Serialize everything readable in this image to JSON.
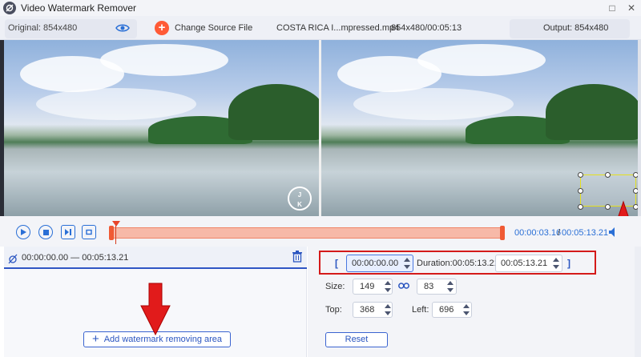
{
  "window": {
    "title": "Video Watermark Remover",
    "restore_symbol": "□",
    "close_symbol": "✕"
  },
  "topbar": {
    "original_label": "Original: 854x480",
    "change_source_label": "Change Source File",
    "change_source_plus": "+",
    "filename": "COSTA RICA I...mpressed.mp4",
    "file_info": "854x480/00:05:13",
    "output_label": "Output: 854x480"
  },
  "video": {
    "watermark_letters": "J\nK"
  },
  "controls": {
    "current_time": "00:00:03.16",
    "separator": "/",
    "total_time": "00:05:13.21"
  },
  "segments": {
    "items": [
      {
        "range": "00:00:00.00 — 00:05:13.21"
      }
    ]
  },
  "add_area_button": {
    "plus": "+",
    "label": "Add watermark removing area"
  },
  "timing": {
    "bracket_open": "[",
    "start_value": "00:00:00.00",
    "duration_label": "Duration:00:05:13.21",
    "end_value": "00:05:13.21",
    "bracket_close": "]"
  },
  "size": {
    "label": "Size:",
    "width": "149",
    "height": "83"
  },
  "position": {
    "top_label": "Top:",
    "top_value": "368",
    "left_label": "Left:",
    "left_value": "696"
  },
  "reset_label": "Reset",
  "colors": {
    "accent": "#2a6fd6",
    "timeline": "#f7b9a8",
    "timeline_handle": "#f05a34",
    "annotation_red": "#d41a1a",
    "selection_yellow": "#e6e020"
  }
}
